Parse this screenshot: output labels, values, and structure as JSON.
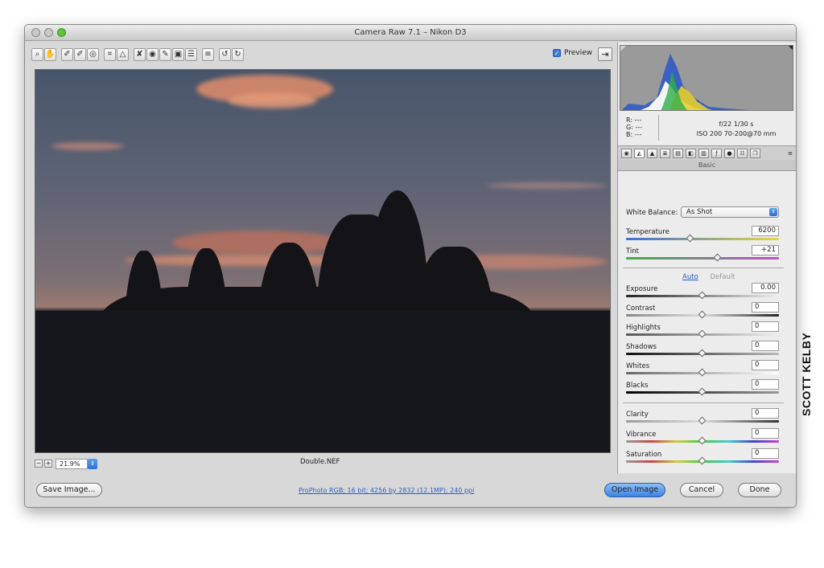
{
  "window": {
    "title": "Camera Raw 7.1  –  Nikon D3"
  },
  "toolbar": {
    "tools": [
      "zoom-tool",
      "hand-tool",
      "white-balance-tool",
      "color-sampler-tool",
      "targeted-adjustment-tool",
      "crop-tool",
      "straighten-tool",
      "spot-removal-tool",
      "red-eye-tool",
      "adjustment-brush-tool",
      "graduated-filter-tool",
      "radial-tool",
      "preferences-tool",
      "rotate-ccw-tool",
      "rotate-cw-tool"
    ],
    "tool_glyphs": [
      "⌕",
      "✋",
      "✐",
      "✐",
      "◎",
      "⌗",
      "△",
      "✘",
      "◉",
      "✎",
      "▣",
      "☰",
      "≡",
      "↺",
      "↻"
    ],
    "preview_label": "Preview",
    "preview_checked": true
  },
  "status": {
    "zoom_value": "21.9%",
    "filename": "Double.NEF"
  },
  "readout": {
    "r": "R:  ---",
    "g": "G:  ---",
    "b": "B:  ---",
    "aperture_shutter": "f/22   1/30 s",
    "iso_lens": "ISO 200   70-200@70 mm"
  },
  "panel": {
    "title": "Basic",
    "white_balance_label": "White Balance:",
    "white_balance_value": "As Shot",
    "temperature_label": "Temperature",
    "temperature_value": "6200",
    "tint_label": "Tint",
    "tint_value": "+21",
    "auto_label": "Auto",
    "default_label": "Default",
    "exposure_label": "Exposure",
    "exposure_value": "0.00",
    "contrast_label": "Contrast",
    "contrast_value": "0",
    "highlights_label": "Highlights",
    "highlights_value": "0",
    "shadows_label": "Shadows",
    "shadows_value": "0",
    "whites_label": "Whites",
    "whites_value": "0",
    "blacks_label": "Blacks",
    "blacks_value": "0",
    "clarity_label": "Clarity",
    "clarity_value": "0",
    "vibrance_label": "Vibrance",
    "vibrance_value": "0",
    "saturation_label": "Saturation",
    "saturation_value": "0"
  },
  "footer": {
    "save_label": "Save Image...",
    "workflow_link": "ProPhoto RGB; 16 bit; 4256 by 2832 (12.1MP); 240 ppi",
    "open_label": "Open Image",
    "cancel_label": "Cancel",
    "done_label": "Done"
  },
  "credit": "SCOTT KELBY"
}
